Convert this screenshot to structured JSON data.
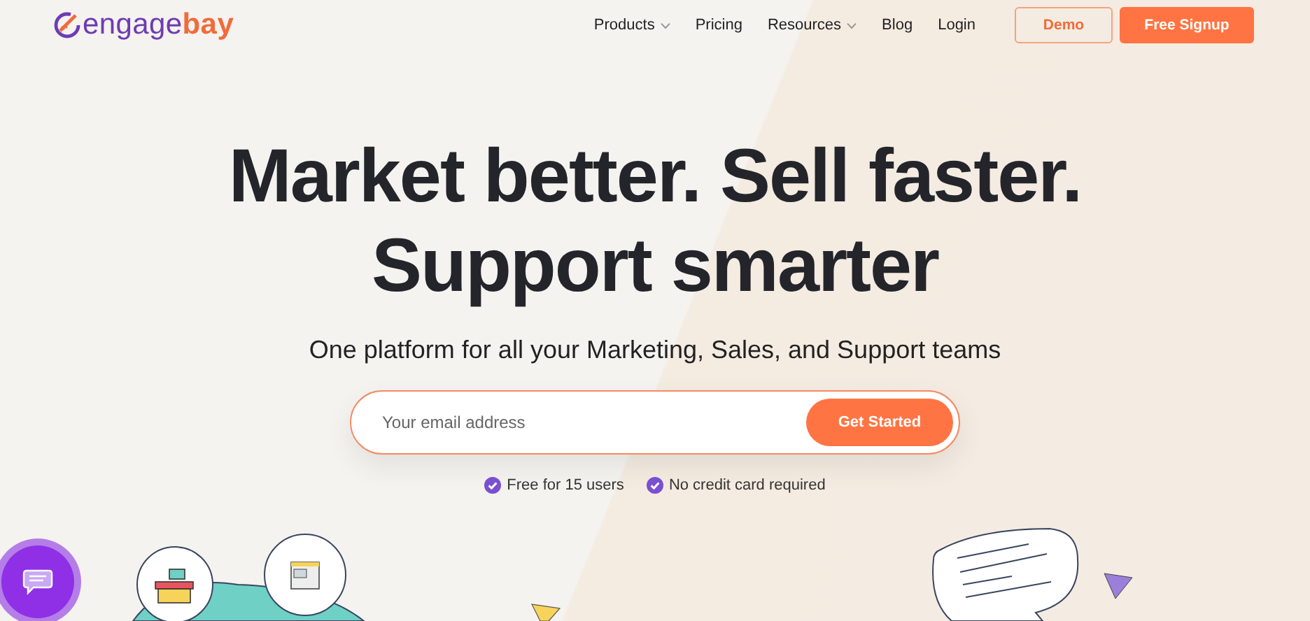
{
  "brand": {
    "first": "engage",
    "second": "bay"
  },
  "nav": [
    {
      "label": "Products",
      "dropdown": true
    },
    {
      "label": "Pricing",
      "dropdown": false
    },
    {
      "label": "Resources",
      "dropdown": true
    },
    {
      "label": "Blog",
      "dropdown": false
    },
    {
      "label": "Login",
      "dropdown": false
    }
  ],
  "buttons": [
    {
      "label": "Demo",
      "kind": "outline"
    },
    {
      "label": "Free Signup",
      "kind": "solid"
    }
  ],
  "headline": [
    "Market better. Sell faster.",
    "Support smarter"
  ],
  "subtitle": "One platform for all your Marketing, Sales, and Support teams",
  "signup": {
    "placeholder": "Your email address",
    "button": "Get Started"
  },
  "perks": [
    "Free for 15 users",
    "No credit card required"
  ]
}
